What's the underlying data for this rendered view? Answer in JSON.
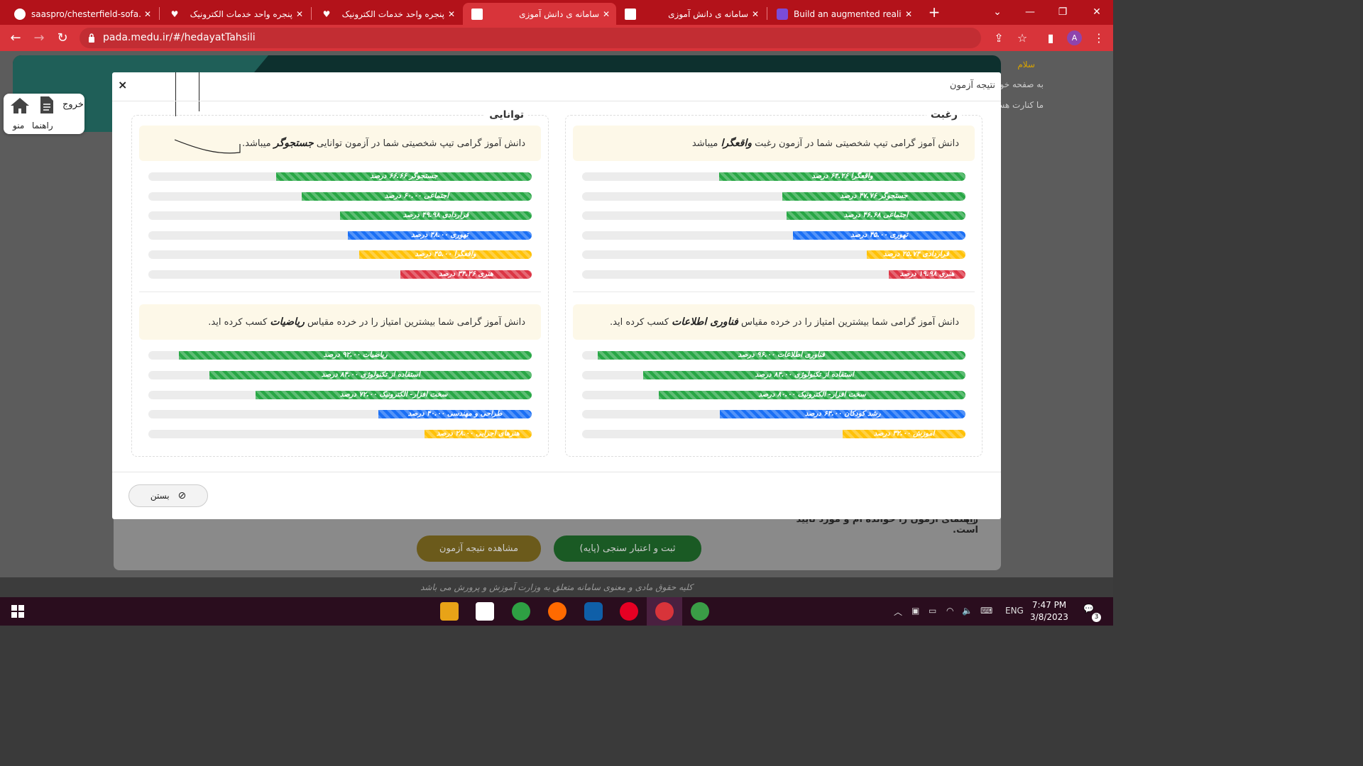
{
  "browser": {
    "tabs": [
      {
        "title": "saaspro/chesterfield-sofa.gl",
        "close": "✕"
      },
      {
        "title": "پنجره واحد خدمات الکترونیک",
        "close": "✕"
      },
      {
        "title": "پنجره واحد خدمات الکترونیک",
        "close": "✕"
      },
      {
        "title": "سامانه ی دانش آموزی",
        "close": "✕"
      },
      {
        "title": "سامانه ی دانش آموزی",
        "close": "✕"
      },
      {
        "title": "Build an augmented reality",
        "close": "✕"
      }
    ],
    "active_tab": 3,
    "new_tab": "+",
    "url": "pada.medu.ir/#/hedayatTahsili",
    "avatar_letter": "A"
  },
  "background_page": {
    "greeting": "سلام",
    "line2": "به صفحه خو",
    "line3": "ما کنارت هس",
    "side_menu": {
      "exit": "خروج",
      "guide": "راهنما",
      "menu": "منو"
    },
    "consent": "راهنمای آزمون را خوانده ام و مورد تایید است.",
    "register_button": "ثبت و اعتبار سنجی (پایه)",
    "view_result_button": "مشاهده نتیجه آزمون",
    "footer": "کلیه حقوق مادی و معنوی سامانه متعلق به وزارت آموزش و پرورش می باشد"
  },
  "modal": {
    "title": "نتیجه آزمون",
    "close_icon": "×",
    "close_button": "بستن",
    "interest": {
      "legend": "رغبت",
      "message_pre": "دانش آموز گرامی تیپ شخصیتی شما در آزمون رغبت",
      "message_type": "واقعگرا",
      "message_post": "میباشد",
      "bars": [
        {
          "label": "واقعگرا ۶۴.۲۶ درصد",
          "value": 64.26,
          "color": "#28a745"
        },
        {
          "label": "جستجوگر ۴۷.۷۶ درصد",
          "value": 47.76,
          "color": "#28a745"
        },
        {
          "label": "اجتماعی ۴۶.۶۸ درصد",
          "value": 46.68,
          "color": "#28a745"
        },
        {
          "label": "تهوری ۴۵.۰۰ درصد",
          "value": 45.0,
          "color": "#1a6ff5"
        },
        {
          "label": "قراردادی ۲۵.۷۴ درصد",
          "value": 25.74,
          "color": "#ffc107"
        },
        {
          "label": "هنری ۱۹.۹۸ درصد",
          "value": 19.98,
          "color": "#dc3545"
        }
      ],
      "scale_message_pre": "دانش آموز گرامی شما بیشترین امتیاز را در خرده مقیاس",
      "scale_type": "فناوری اطلاعات",
      "scale_message_post": "کسب کرده اید.",
      "scales": [
        {
          "label": "فناوری اطلاعات ۹۶.۰۰ درصد",
          "value": 96.0,
          "color": "#28a745"
        },
        {
          "label": "استفاده از تکنولوژی ۸۴.۰۰ درصد",
          "value": 84.0,
          "color": "#28a745"
        },
        {
          "label": "سخت افزار- الکترونیک ۸۰.۰۰ درصد",
          "value": 80.0,
          "color": "#28a745"
        },
        {
          "label": "رشد کودکان ۶۴.۰۰ درصد",
          "value": 64.0,
          "color": "#1a6ff5"
        },
        {
          "label": "آموزش ۳۲.۰۰ درصد",
          "value": 32.0,
          "color": "#ffc107"
        }
      ]
    },
    "ability": {
      "legend": "توانایی",
      "message_pre": "دانش آموز گرامی تیپ شخصیتی شما در آزمون توانایی",
      "message_type": "جستجوگر",
      "message_post": "میباشد.",
      "bars": [
        {
          "label": "جستجوگر ۶۶.۶۶ درصد",
          "value": 66.66,
          "color": "#28a745"
        },
        {
          "label": "اجتماعی ۶۰.۰۰ درصد",
          "value": 60.0,
          "color": "#28a745"
        },
        {
          "label": "قراردادی ۴۹.۹۸ درصد",
          "value": 49.98,
          "color": "#28a745"
        },
        {
          "label": "تهوری ۴۸.۰۰ درصد",
          "value": 48.0,
          "color": "#1a6ff5"
        },
        {
          "label": "واقعگرا ۴۵.۰۰ درصد",
          "value": 45.0,
          "color": "#ffc107"
        },
        {
          "label": "هنری ۳۴.۲۶ درصد",
          "value": 34.26,
          "color": "#dc3545"
        }
      ],
      "scale_message_pre": "دانش آموز گرامی شما بیشترین امتیاز را در خرده مقیاس",
      "scale_type": "ریاضیات",
      "scale_message_post": "کسب کرده اید.",
      "scales": [
        {
          "label": "ریاضیات ۹۲.۰۰ درصد",
          "value": 92.0,
          "color": "#28a745"
        },
        {
          "label": "استفاده از تکنولوژی ۸۴.۰۰ درصد",
          "value": 84.0,
          "color": "#28a745"
        },
        {
          "label": "سخت افزار- الکترونیک ۷۲.۰۰ درصد",
          "value": 72.0,
          "color": "#28a745"
        },
        {
          "label": "طراحی و مهندسی ۴۰.۰۰ درصد",
          "value": 40.0,
          "color": "#1a6ff5"
        },
        {
          "label": "هنرهای اجرایی ۲۸.۰۰ درصد",
          "value": 28.0,
          "color": "#ffc107"
        }
      ]
    }
  },
  "taskbar": {
    "lang": "ENG",
    "time": "7:47 PM",
    "date": "3/8/2023",
    "notif_count": "3"
  }
}
